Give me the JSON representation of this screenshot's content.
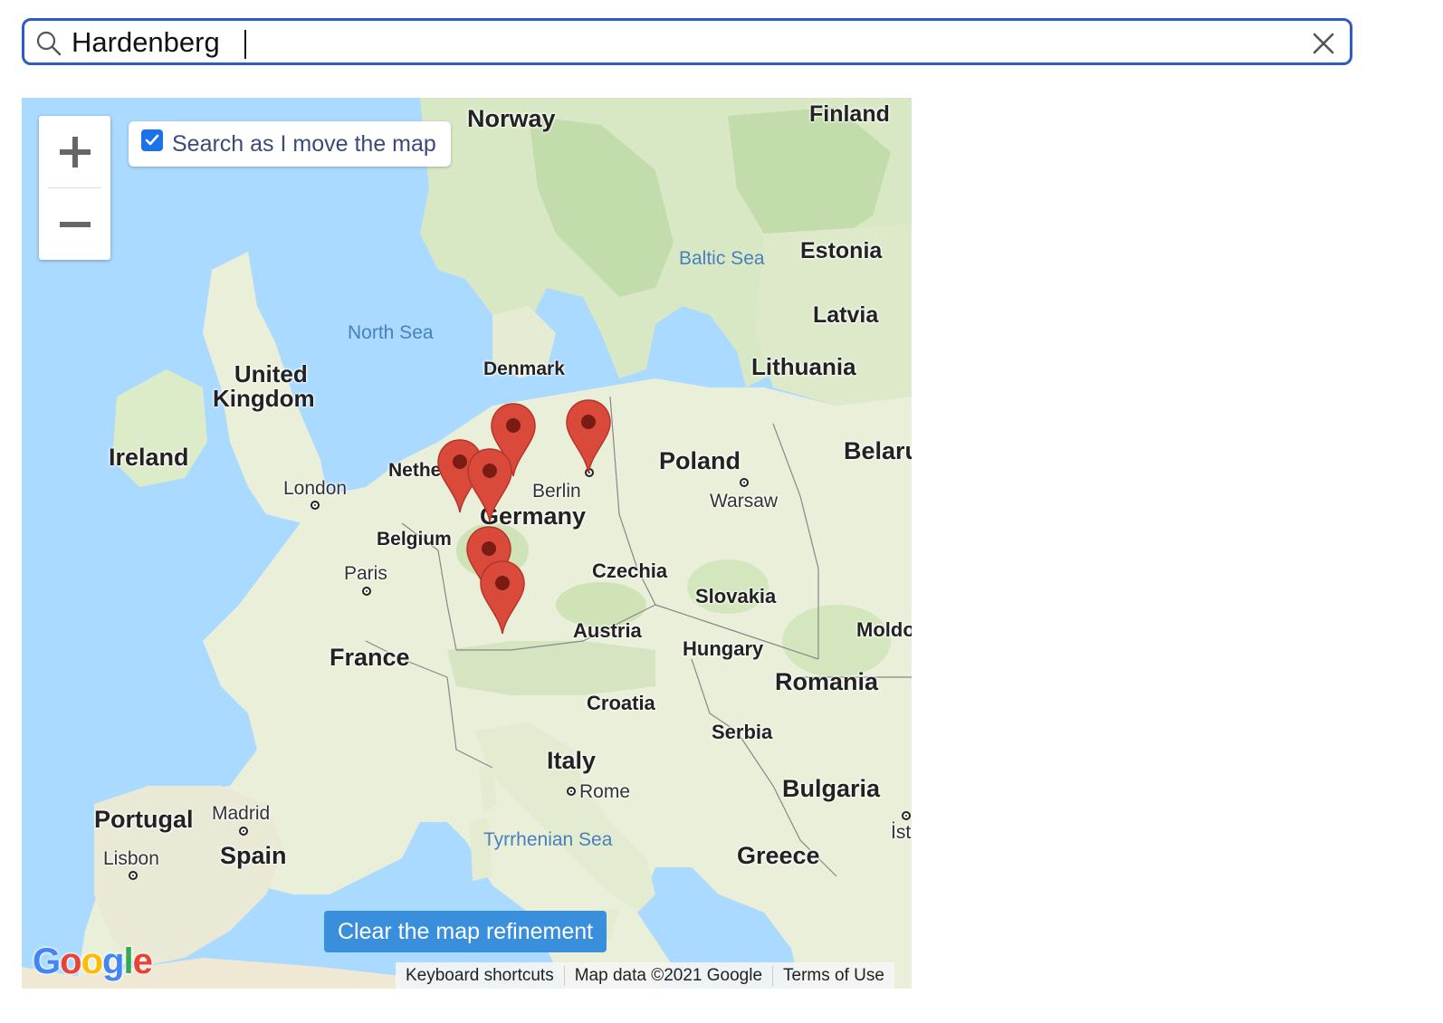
{
  "search": {
    "value": "Hardenberg",
    "icon": "search-icon",
    "clear_icon": "close-icon"
  },
  "map": {
    "controls": {
      "zoom_in": "+",
      "zoom_out": "−"
    },
    "refine_checkbox": {
      "label": "Search as I move the map",
      "checked": true
    },
    "clear_refinement_label": "Clear the map refinement",
    "attribution": {
      "keyboard_shortcuts": "Keyboard shortcuts",
      "map_data": "Map data ©2021 Google",
      "terms": "Terms of Use"
    },
    "logo_text": "Google",
    "countries": {
      "norway": "Norway",
      "finland": "Finland",
      "estonia": "Estonia",
      "latvia": "Latvia",
      "lithuania": "Lithuania",
      "denmark": "Denmark",
      "united_kingdom_1": "United",
      "united_kingdom_2": "Kingdom",
      "ireland": "Ireland",
      "netherlands": "Nethe",
      "belgium": "Belgium",
      "germany": "Germany",
      "poland": "Poland",
      "belarus": "Belaru",
      "czechia": "Czechia",
      "slovakia": "Slovakia",
      "austria": "Austria",
      "hungary": "Hungary",
      "moldova": "Moldo",
      "romania": "Romania",
      "france": "France",
      "croatia": "Croatia",
      "serbia": "Serbia",
      "italy": "Italy",
      "bulgaria": "Bulgaria",
      "portugal": "Portugal",
      "spain": "Spain",
      "greece": "Greece"
    },
    "cities": {
      "london": "London",
      "paris": "Paris",
      "berlin": "Berlin",
      "warsaw": "Warsaw",
      "rome": "Rome",
      "madrid": "Madrid",
      "lisbon": "Lisbon",
      "istanbul": "İstan"
    },
    "seas": {
      "north_sea": "North Sea",
      "baltic_sea": "Baltic Sea",
      "tyrrhenian_sea": "Tyrrhenian Sea"
    },
    "marker_count": 6
  },
  "colors": {
    "accent": "#2c5cc5",
    "water": "#aadaff",
    "land": "#e9efd8",
    "forest": "#c8dfb0",
    "marker": "#d94a3b",
    "button": "#3a8fdc"
  }
}
